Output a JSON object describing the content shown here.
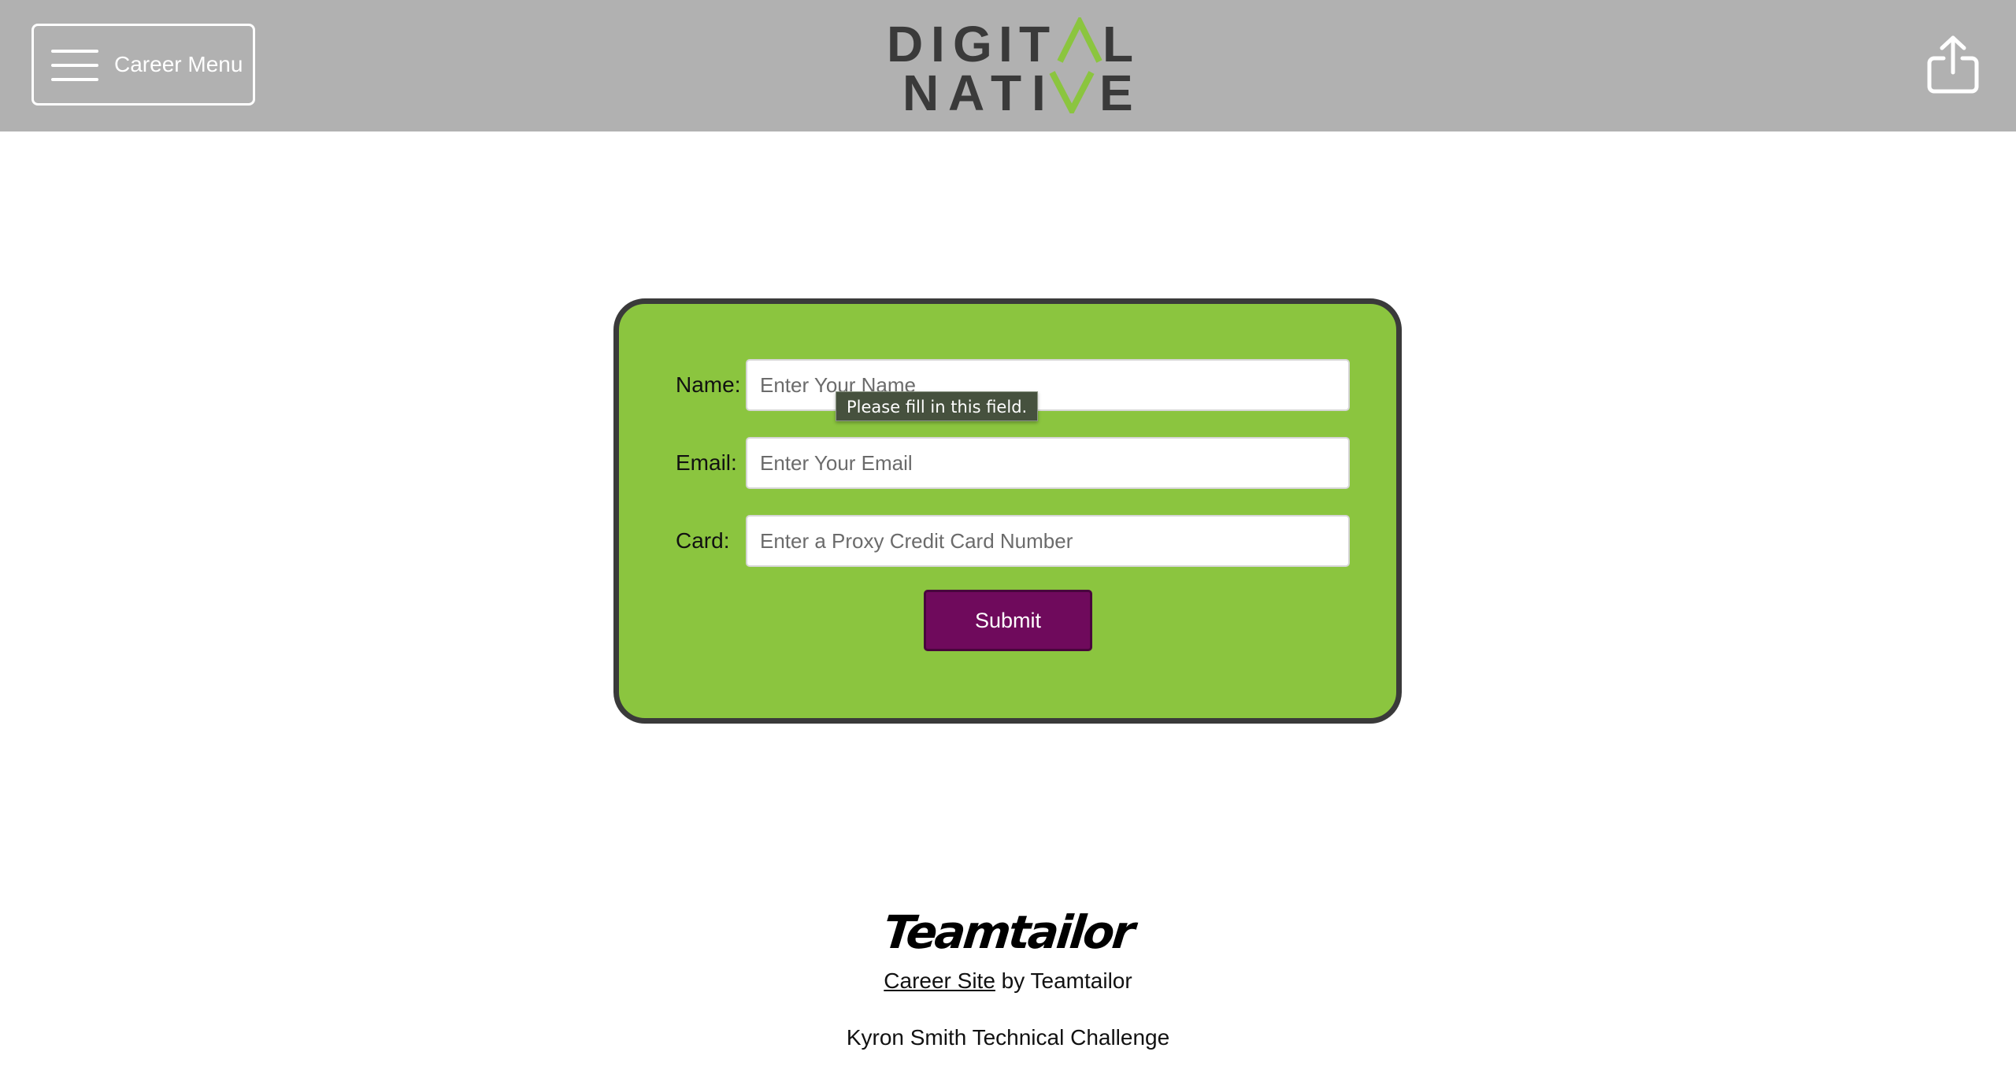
{
  "header": {
    "menu_label": "Career Menu",
    "menu_icon": "hamburger-icon",
    "logo_line1": "DIGITAL",
    "logo_line2": "NATIVE",
    "logo_colors": {
      "text": "#3a3a3a",
      "accent": "#8bc53f"
    },
    "share_icon": "share-icon"
  },
  "form": {
    "fields": [
      {
        "label": "Name:",
        "placeholder": "Enter Your Name",
        "value": ""
      },
      {
        "label": "Email:",
        "placeholder": "Enter Your Email",
        "value": ""
      },
      {
        "label": "Card:",
        "placeholder": "Enter a Proxy Credit Card Number",
        "value": ""
      }
    ],
    "validation_tooltip": "Please fill in this field.",
    "submit_label": "Submit"
  },
  "footer": {
    "brand": "Teamtailor",
    "credit_link": "Career Site",
    "credit_suffix": " by Teamtailor",
    "note": "Kyron Smith Technical Challenge"
  },
  "colors": {
    "header_bg": "#b1b1b1",
    "card_bg": "#8bc53f",
    "card_border": "#3a3a3a",
    "submit_bg": "#6f0a5c"
  }
}
